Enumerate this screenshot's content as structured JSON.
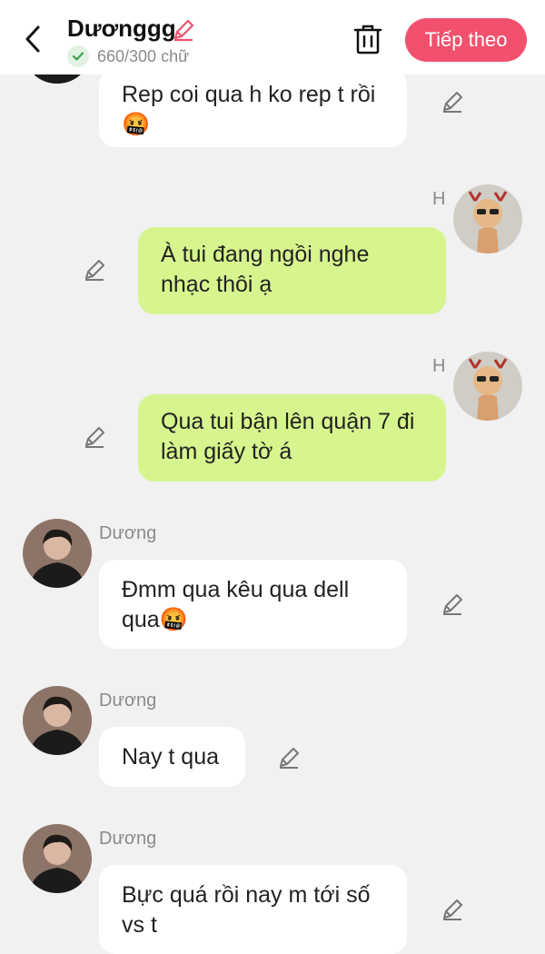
{
  "header": {
    "title": "Dươnggg",
    "char_count": "660/300 chữ",
    "next_label": "Tiếp theo"
  },
  "messages": [
    {
      "text": "Rep coi qua h ko rep t rồi🤬"
    },
    {
      "sender": "H",
      "text": "À tui đang ngồi nghe nhạc thôi ạ"
    },
    {
      "sender": "H",
      "text": "Qua tui bận lên quận 7 đi làm giấy tờ á"
    },
    {
      "sender": "Dương",
      "text": "Đmm qua kêu qua dell qua🤬"
    },
    {
      "sender": "Dương",
      "text": "Nay t qua"
    },
    {
      "sender": "Dương",
      "text": "Bực quá rồi nay m tới số vs t"
    }
  ],
  "colors": {
    "accent": "#f2516e",
    "right_bubble": "#d6f58e",
    "left_bubble": "#ffffff",
    "background": "#f1f1f1"
  }
}
